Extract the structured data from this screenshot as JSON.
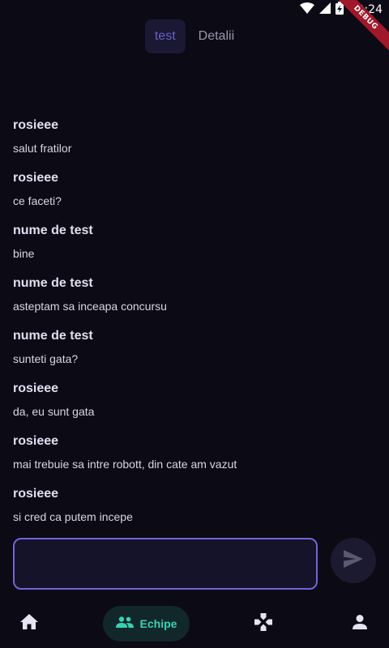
{
  "status_bar": {
    "time": "10:24",
    "icons": [
      "wifi-icon",
      "signal-icon",
      "battery-charging-icon"
    ],
    "debug_banner": "DEBUG"
  },
  "tabs": [
    {
      "label": "test",
      "active": true
    },
    {
      "label": "Detalii",
      "active": false
    }
  ],
  "messages": [
    {
      "author": "rosieee",
      "text": "salut fratilor"
    },
    {
      "author": "rosieee",
      "text": "ce faceti?"
    },
    {
      "author": "nume de test",
      "text": "bine"
    },
    {
      "author": "nume de test",
      "text": "asteptam sa inceapa concursu"
    },
    {
      "author": "nume de test",
      "text": "sunteti gata?"
    },
    {
      "author": "rosieee",
      "text": "da, eu sunt gata"
    },
    {
      "author": "rosieee",
      "text": "mai trebuie sa intre robott, din cate am vazut"
    },
    {
      "author": "rosieee",
      "text": "si cred ca putem incepe"
    }
  ],
  "composer": {
    "value": "",
    "send_icon": "send-icon"
  },
  "bottom_nav": {
    "items": [
      {
        "icon": "home-icon",
        "label": ""
      },
      {
        "icon": "group-icon",
        "label": "Echipe",
        "active": true
      },
      {
        "icon": "gamepad-icon",
        "label": ""
      },
      {
        "icon": "person-icon",
        "label": ""
      }
    ]
  },
  "colors": {
    "background": "#0b0a15",
    "accent_purple": "#7265d6",
    "active_tab_text": "#6b5fc7",
    "nav_active": "#39d2b4"
  }
}
